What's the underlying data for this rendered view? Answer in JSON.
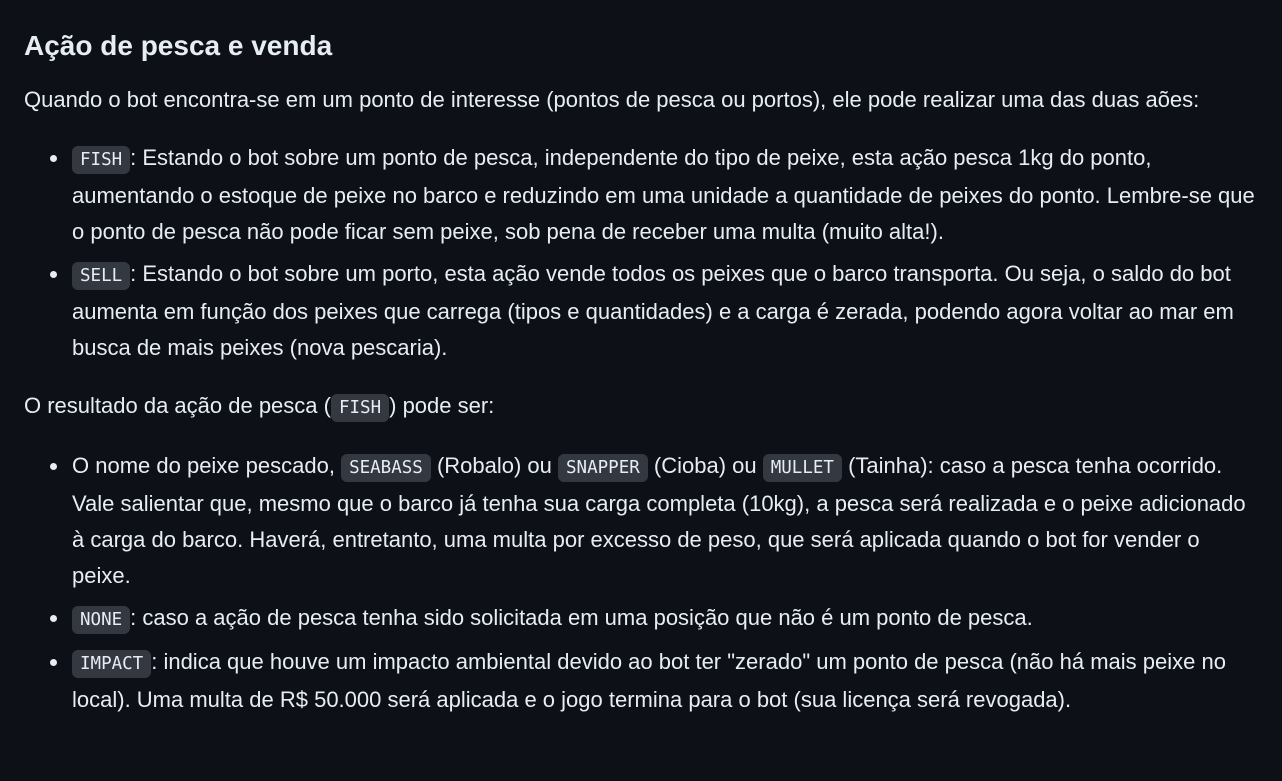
{
  "heading": "Ação de pesca e venda",
  "intro": "Quando o bot encontra-se em um ponto de interesse (pontos de pesca ou portos), ele pode realizar uma das duas aões:",
  "actions": [
    {
      "code": "FISH",
      "text": ": Estando o bot sobre um ponto de pesca, independente do tipo de peixe, esta ação pesca 1kg do ponto, aumentando o estoque de peixe no barco e reduzindo em uma unidade a quantidade de peixes do ponto. Lembre-se que o ponto de pesca não pode ficar sem peixe, sob pena de receber uma multa (muito alta!)."
    },
    {
      "code": "SELL",
      "text": ": Estando o bot sobre um porto, esta ação vende todos os peixes que o barco transporta. Ou seja, o saldo do bot aumenta em função dos peixes que carrega (tipos e quantidades) e a carga é zerada, podendo agora voltar ao mar em busca de mais peixes (nova pescaria)."
    }
  ],
  "result": {
    "before": "O resultado da ação de pesca (",
    "code": "FISH",
    "after": ") pode ser:"
  },
  "results": {
    "fish_name": {
      "t1": "O nome do peixe pescado, ",
      "c1": "SEABASS",
      "t2": " (Robalo) ou ",
      "c2": "SNAPPER",
      "t3": " (Cioba) ou ",
      "c3": "MULLET",
      "t4": " (Tainha): caso a pesca tenha ocorrido. Vale salientar que, mesmo que o barco já tenha sua carga completa (10kg), a pesca será realizada e o peixe adicionado à carga do barco. Haverá, entretanto, uma multa por excesso de peso, que será aplicada quando o bot for vender o peixe."
    },
    "none": {
      "code": "NONE",
      "text": ": caso a ação de pesca tenha sido solicitada em uma posição que não é um ponto de pesca."
    },
    "impact": {
      "code": "IMPACT",
      "text": ": indica que houve um impacto ambiental devido ao bot ter \"zerado\" um ponto de pesca (não há mais peixe no local). Uma multa de R$ 50.000 será aplicada e o jogo termina para o bot (sua licença será revogada)."
    }
  }
}
